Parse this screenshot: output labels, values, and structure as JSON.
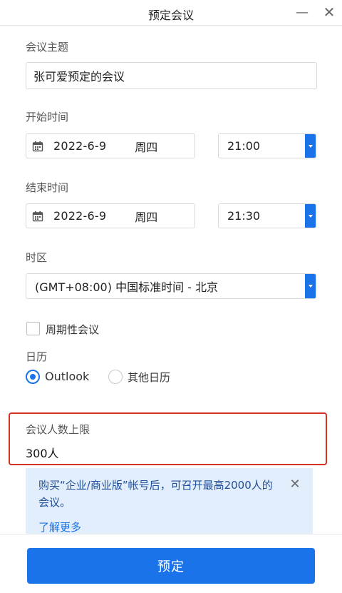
{
  "window": {
    "title": "预定会议",
    "minimize_symbol": "—",
    "close_symbol": "✕"
  },
  "form": {
    "topic": {
      "label": "会议主题",
      "value": "张可爱预定的会议"
    },
    "start": {
      "label": "开始时间",
      "date": "2022-6-9",
      "weekday": "周四",
      "time": "21:00"
    },
    "end": {
      "label": "结束时间",
      "date": "2022-6-9",
      "weekday": "周四",
      "time": "21:30"
    },
    "timezone": {
      "label": "时区",
      "value": "(GMT+08:00) 中国标准时间 - 北京"
    },
    "recurring": {
      "label": "周期性会议",
      "checked": false
    },
    "calendar": {
      "label": "日历",
      "options": [
        {
          "label": "Outlook",
          "selected": true
        },
        {
          "label": "其他日历",
          "selected": false
        }
      ]
    },
    "capacity": {
      "label": "会议人数上限",
      "value": "300人"
    }
  },
  "notice": {
    "text": "购买“企业/商业版”帐号后，可召开最高2000人的会议。",
    "link": "了解更多",
    "close_symbol": "✕"
  },
  "footer": {
    "submit_label": "预定"
  },
  "colors": {
    "accent": "#1a73e8",
    "highlight_border": "#d93025",
    "notice_bg": "#e3eefc"
  },
  "icons": {
    "date": "calendar-icon",
    "dropdown": "chevron-down-icon",
    "close": "close-icon"
  }
}
